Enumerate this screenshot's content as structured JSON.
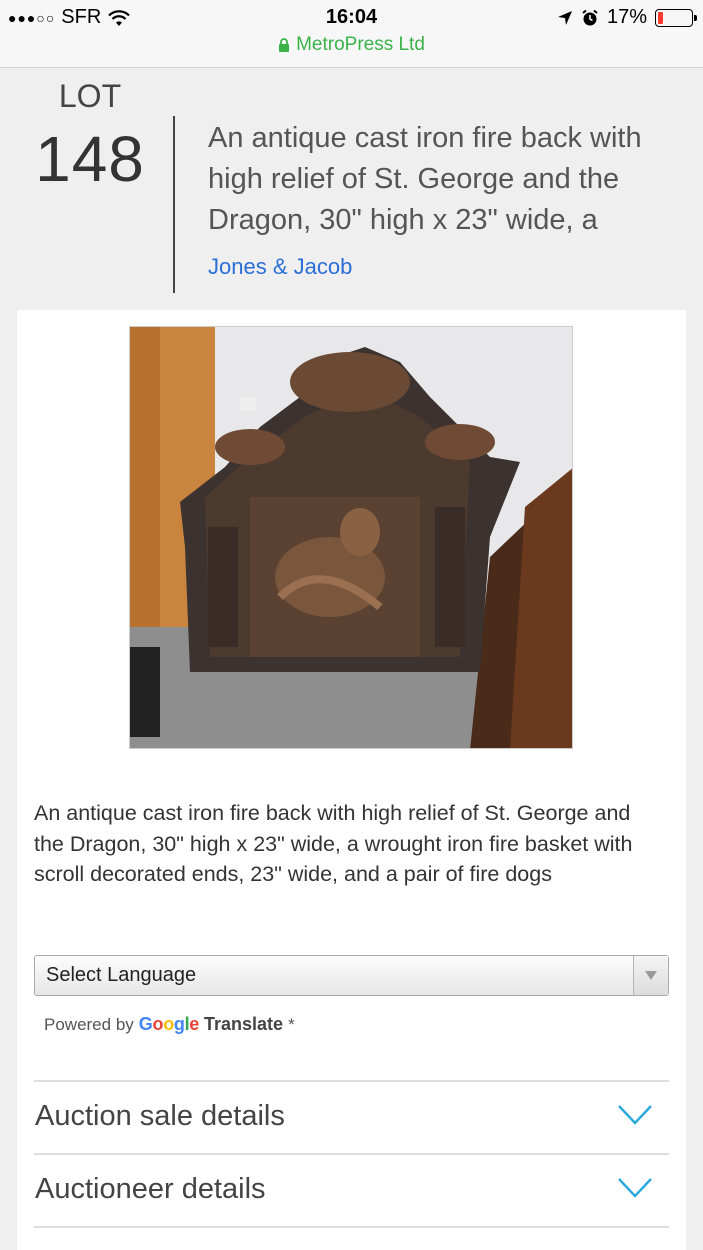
{
  "status_bar": {
    "signal": "●●●○○",
    "carrier": "SFR",
    "time": "16:04",
    "battery": "17%",
    "battery_level": 0.17,
    "battery_color": "#ff3b30"
  },
  "url_bar": {
    "site": "MetroPress Ltd",
    "color": "#3cb34a"
  },
  "lot": {
    "label": "LOT",
    "number": "148",
    "title": "An antique cast iron fire back with high relief of St. George and the Dragon, 30\" high x 23\" wide, a",
    "auctioneer": "Jones & Jacob",
    "link_color": "#2b6fd6"
  },
  "image": {
    "alt_icon": "photo-fire-back"
  },
  "description": "An antique cast iron fire back with high relief of St. George and the Dragon, 30\" high x 23\" wide, a wrought iron fire basket with scroll decorated ends, 23\" wide, and a pair of fire dogs",
  "translate": {
    "select_label": "Select Language",
    "powered_by": "Powered by",
    "google": "Google",
    "translate": "Translate",
    "asterisk": "*"
  },
  "accordion": [
    {
      "label": "Auction sale details"
    },
    {
      "label": "Auctioneer details"
    }
  ],
  "accent_color": "#29a8e0"
}
